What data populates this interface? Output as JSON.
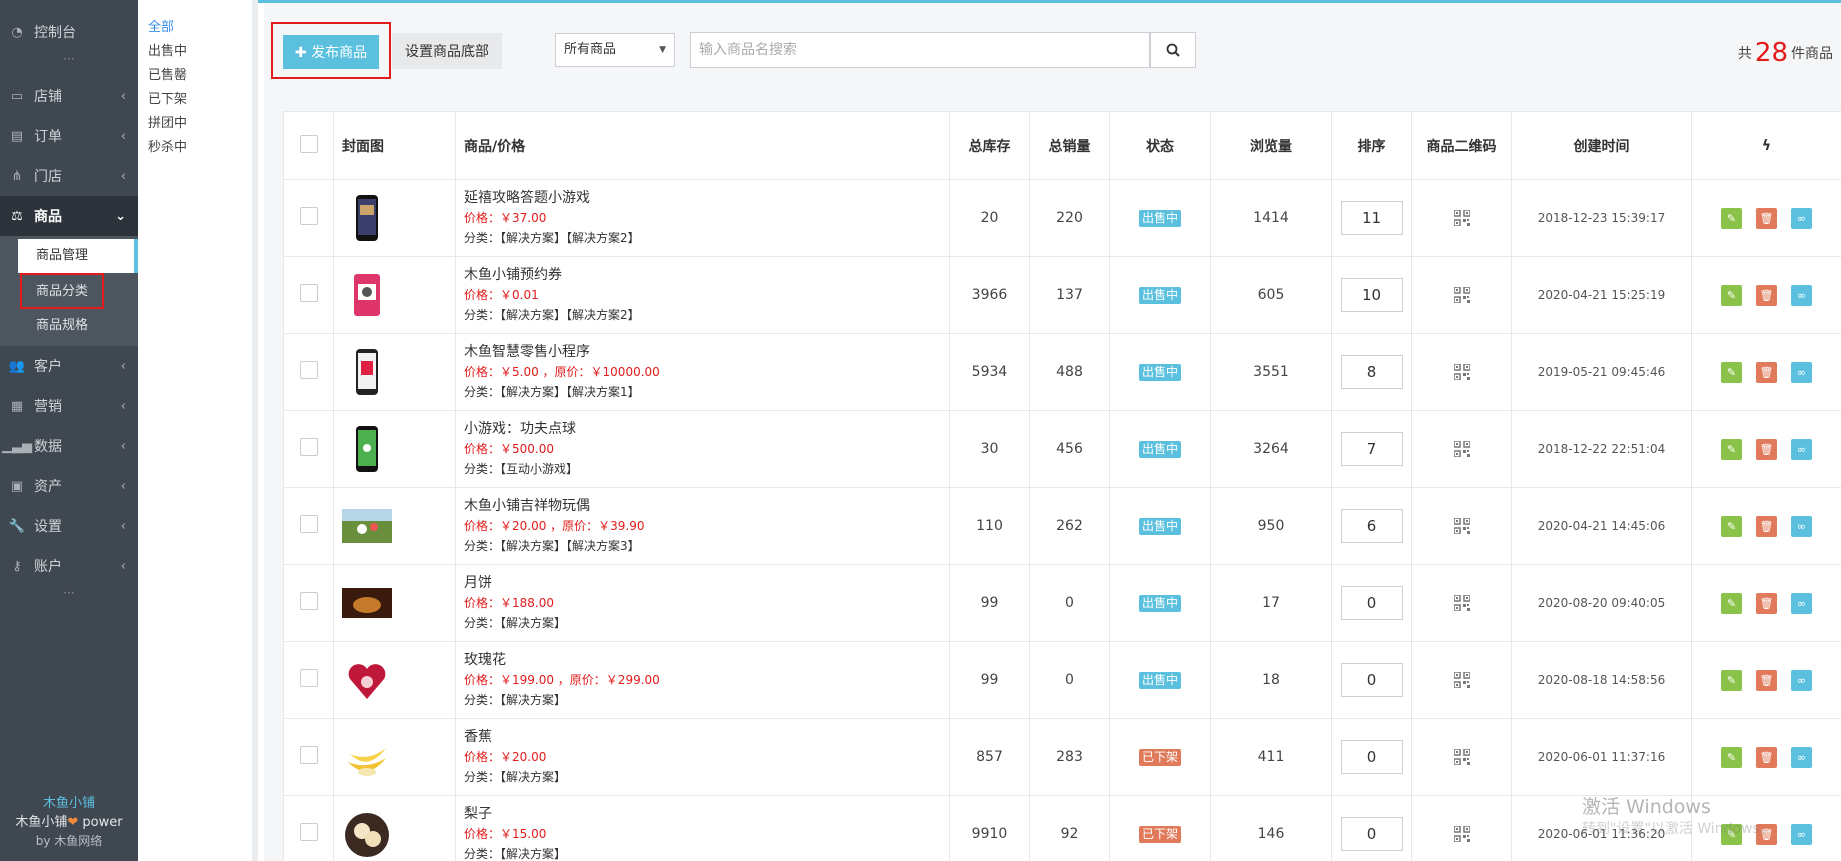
{
  "sidebar": {
    "items": [
      {
        "label": "控制台",
        "icon": "dashboard-icon"
      },
      {
        "label": "店铺",
        "icon": "store-icon"
      },
      {
        "label": "订单",
        "icon": "order-icon"
      },
      {
        "label": "门店",
        "icon": "branch-icon"
      },
      {
        "label": "商品",
        "icon": "scale-icon"
      },
      {
        "label": "客户",
        "icon": "users-icon"
      },
      {
        "label": "营销",
        "icon": "marketing-icon"
      },
      {
        "label": "数据",
        "icon": "chart-icon"
      },
      {
        "label": "资产",
        "icon": "money-icon"
      },
      {
        "label": "设置",
        "icon": "wrench-icon"
      },
      {
        "label": "账户",
        "icon": "key-icon"
      }
    ],
    "sub_items": [
      "商品管理",
      "商品分类",
      "商品规格"
    ],
    "footer": {
      "brand": "木鱼小铺",
      "power_prefix": "木鱼小铺",
      "power_suffix": " power",
      "by": "by 木鱼网络"
    }
  },
  "subnav": [
    "全部",
    "出售中",
    "已售罄",
    "已下架",
    "拼团中",
    "秒杀中"
  ],
  "toolbar": {
    "publish_label": "✚ 发布商品",
    "bottom_label": "设置商品底部",
    "select_value": "所有商品",
    "search_placeholder": "输入商品名搜索",
    "total_prefix": "共",
    "total_count": "28",
    "total_suffix": "件商品"
  },
  "table": {
    "headers": [
      "封面图",
      "商品/价格",
      "总库存",
      "总销量",
      "状态",
      "浏览量",
      "排序",
      "商品二维码",
      "创建时间"
    ],
    "rows": [
      {
        "name": "延禧攻略答题小游戏",
        "price": "价格：￥37.00",
        "cats": "分类：【解决方案】【解决方案2】",
        "stock": "20",
        "sales": "220",
        "status": "出售中",
        "views": "1414",
        "sort": "11",
        "created": "2018-12-23 15:39:17"
      },
      {
        "name": "木鱼小铺预约券",
        "price": "价格：￥0.01",
        "cats": "分类：【解决方案】【解决方案2】",
        "stock": "3966",
        "sales": "137",
        "status": "出售中",
        "views": "605",
        "sort": "10",
        "created": "2020-04-21 15:25:19"
      },
      {
        "name": "木鱼智慧零售小程序",
        "price": "价格：￥5.00 ，原价：￥10000.00",
        "cats": "分类：【解决方案】【解决方案1】",
        "stock": "5934",
        "sales": "488",
        "status": "出售中",
        "views": "3551",
        "sort": "8",
        "created": "2019-05-21 09:45:46"
      },
      {
        "name": "小游戏：功夫点球",
        "price": "价格：￥500.00",
        "cats": "分类：【互动小游戏】",
        "stock": "30",
        "sales": "456",
        "status": "出售中",
        "views": "3264",
        "sort": "7",
        "created": "2018-12-22 22:51:04"
      },
      {
        "name": "木鱼小铺吉祥物玩偶",
        "price": "价格：￥20.00 ，原价：￥39.90",
        "cats": "分类：【解决方案】【解决方案3】",
        "stock": "110",
        "sales": "262",
        "status": "出售中",
        "views": "950",
        "sort": "6",
        "created": "2020-04-21 14:45:06"
      },
      {
        "name": "月饼",
        "price": "价格：￥188.00",
        "cats": "分类：【解决方案】",
        "stock": "99",
        "sales": "0",
        "status": "出售中",
        "views": "17",
        "sort": "0",
        "created": "2020-08-20 09:40:05"
      },
      {
        "name": "玫瑰花",
        "price": "价格：￥199.00 ，原价：￥299.00",
        "cats": "分类：【解决方案】",
        "stock": "99",
        "sales": "0",
        "status": "出售中",
        "views": "18",
        "sort": "0",
        "created": "2020-08-18 14:58:56"
      },
      {
        "name": "香蕉",
        "price": "价格：￥20.00",
        "cats": "分类：【解决方案】",
        "stock": "857",
        "sales": "283",
        "status": "已下架",
        "views": "411",
        "sort": "0",
        "created": "2020-06-01 11:37:16"
      },
      {
        "name": "梨子",
        "price": "价格：￥15.00",
        "cats": "分类：【解决方案】",
        "stock": "9910",
        "sales": "92",
        "status": "已下架",
        "views": "146",
        "sort": "0",
        "created": "2020-06-01 11:36:20"
      }
    ]
  },
  "watermark": {
    "line1": "激活 Windows",
    "line2": "转到\"设置\"以激活 Windows。"
  },
  "colors": {
    "accent": "#5bc0de",
    "price_red": "#e31b1b",
    "sidebar_bg": "#3f4750",
    "status_on": "#5bc0de",
    "status_off": "#e07a5a",
    "edit": "#8bc34a",
    "delete": "#e07a5a",
    "link": "#5bc0de"
  }
}
